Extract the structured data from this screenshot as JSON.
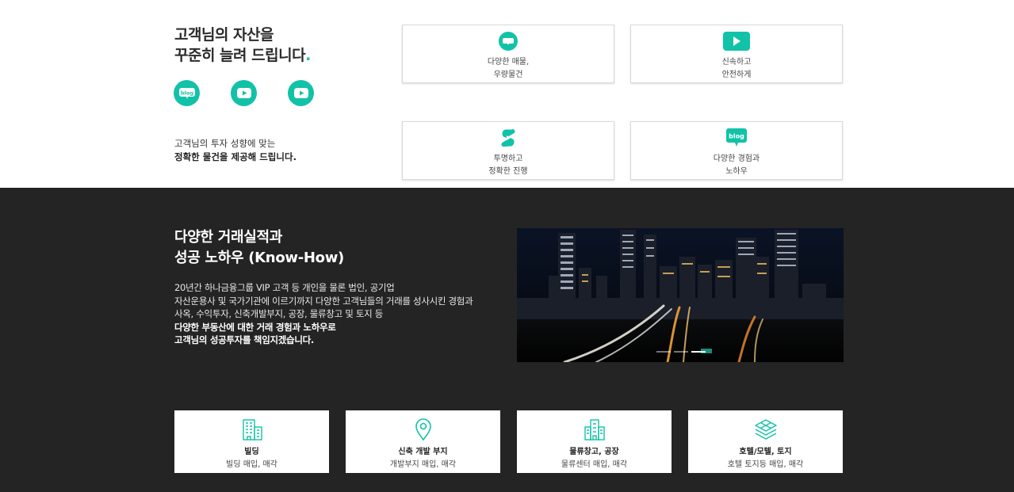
{
  "headline": {
    "line1": "고객님의 자산을",
    "line2": "꾸준히 늘려 드립니다",
    "period": "."
  },
  "social": [
    {
      "icon": "blog-icon",
      "text": "blog"
    },
    {
      "icon": "youtube-icon"
    },
    {
      "icon": "youtube-icon"
    }
  ],
  "subtext": {
    "line1": "고객님의 투자 성향에 맞는",
    "line2": "정확한 물건을 제공해 드립니다",
    "period": "."
  },
  "features": [
    {
      "icon": "blog-icon",
      "line1": "다양한 매물,",
      "line2": "우량물건"
    },
    {
      "icon": "play-icon",
      "line1": "신속하고",
      "line2": "안전하게"
    },
    {
      "icon": "shorts-icon",
      "line1": "투명하고",
      "line2": "정확한 진행"
    },
    {
      "icon": "blog-icon",
      "icon_text": "blog",
      "line1": "다양한 경험과",
      "line2": "노하우"
    }
  ],
  "dark": {
    "title1": "다양한 거래실적과",
    "title2": "성공 노하우 (Know-How)",
    "body1": "20년간 하나금융그룹 VIP 고객 등 개인을 물론 법인, 공기업",
    "body2": "자산운용사 및 국가기관에 이르기까지 다양한 고객님들의 거래를 성사시킨 경험과",
    "body3": "사옥, 수익투자, 신축개발부지, 공장, 물류창고 및 토지 등",
    "body4": "다양한 부동산에 대한 거래 경험과 노하우로",
    "body5": "고객님의 성공투자를 책임지겠습니다",
    "period": "."
  },
  "slider": {
    "slide_count": 3,
    "active": 3
  },
  "services": [
    {
      "icon": "building-icon",
      "title": "빌딩",
      "desc": "빌딩 매입, 매각"
    },
    {
      "icon": "location-pin-icon",
      "title": "신축 개발 부지",
      "desc": "개발부지 매입, 매각"
    },
    {
      "icon": "warehouse-icon",
      "title": "물류창고, 공장",
      "desc": "물류센터 매입, 매각"
    },
    {
      "icon": "layers-icon",
      "title": "호텔/모텔, 토지",
      "desc": "호텔 토지등 매입, 매각"
    }
  ],
  "colors": {
    "accent": "#12c2a8",
    "dark_bg": "#242424"
  }
}
